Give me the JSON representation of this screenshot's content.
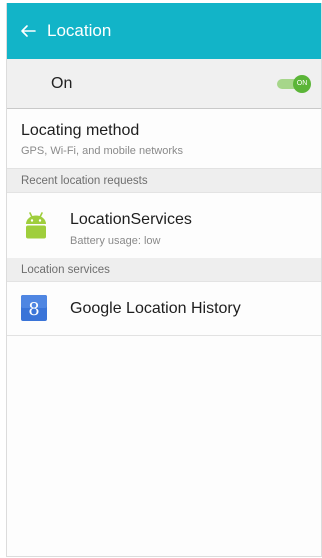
{
  "appbar": {
    "title": "Location",
    "back_icon": "arrow-left-icon"
  },
  "master": {
    "label": "On",
    "toggle_text": "ON",
    "state": "on"
  },
  "locating_method": {
    "title": "Locating method",
    "summary": "GPS, Wi-Fi, and mobile networks"
  },
  "sections": {
    "recent": "Recent location requests",
    "services": "Location services"
  },
  "recent_apps": [
    {
      "name": "LocationServices",
      "detail": "Battery usage: low",
      "icon": "android-icon"
    }
  ],
  "services": [
    {
      "name": "Google Location History",
      "icon": "google-icon"
    }
  ],
  "colors": {
    "accent": "#12b4c8",
    "toggle_on": "#5bb538",
    "android_green": "#9fce3c",
    "google_blue": "#3a74d8"
  }
}
